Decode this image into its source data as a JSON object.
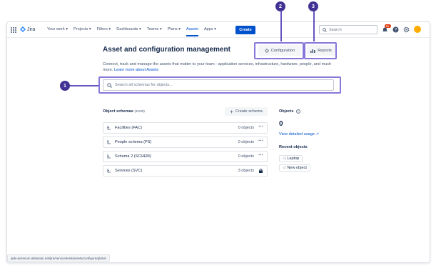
{
  "nav": {
    "logo_text": "Jira",
    "items": [
      "Your work",
      "Projects",
      "Filters",
      "Dashboards",
      "Teams",
      "Plans",
      "Assets",
      "Apps"
    ],
    "create_label": "Create",
    "search_placeholder": "Search",
    "badge": "9+"
  },
  "page": {
    "title": "Asset and configuration management",
    "configuration_label": "Configuration",
    "reports_label": "Reports",
    "description": "Connect, track and manage the assets that matter to your team - application services, infrastructure, hardware, people, and much more.",
    "learn_more": "Learn more about Assets",
    "search_placeholder": "Search all schemas for objects..."
  },
  "callouts": [
    "1",
    "2",
    "3"
  ],
  "schemas": {
    "heading": "Object schemas",
    "count": "(3/100)",
    "create_label": "Create schema",
    "rows": [
      {
        "name": "Facilities",
        "key": "(FAC)",
        "objects": "0 objects"
      },
      {
        "name": "People schema",
        "key": "(PS)",
        "objects": "0 objects"
      },
      {
        "name": "Schema 2",
        "key": "(SCHEM)",
        "objects": "0 objects"
      },
      {
        "name": "Services",
        "key": "(SVC)",
        "objects": "3 objects"
      }
    ]
  },
  "objects": {
    "heading": "Objects",
    "count": "0",
    "view_usage": "View detailed usage",
    "recent_heading": "Recent objects",
    "recent": [
      "Laptop",
      "New object"
    ]
  },
  "status_url": "jade-premium.atlassian.net/jira/servicedesk/assets/configure/global",
  "colors": {
    "accent": "#0052cc",
    "callout": "#403294",
    "highlight": "#8777d9"
  }
}
